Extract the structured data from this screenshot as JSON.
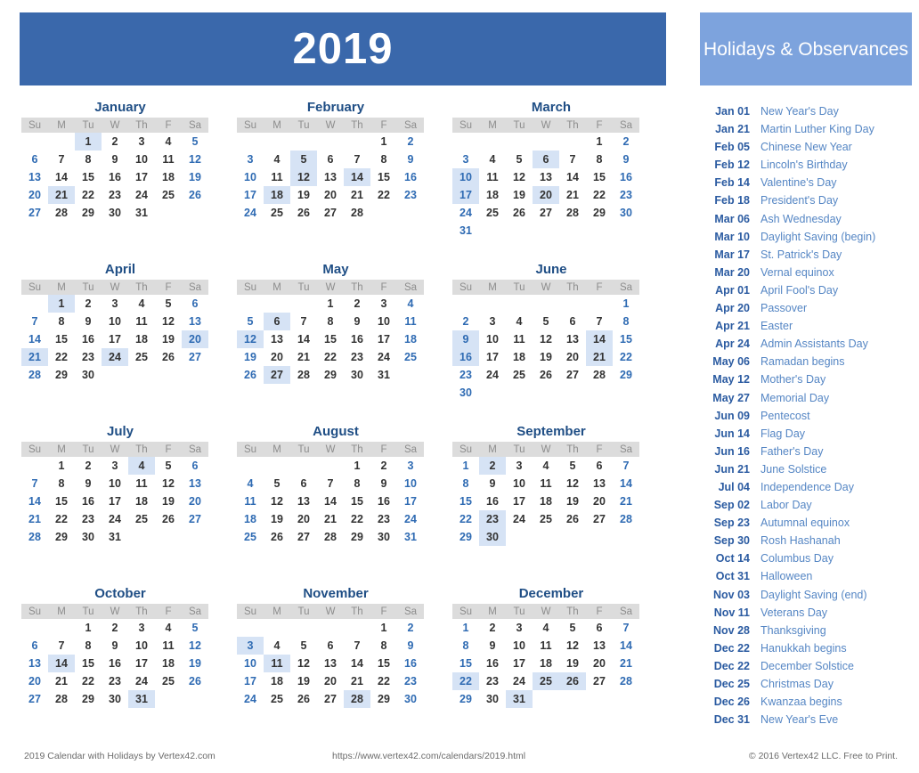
{
  "header": {
    "year": "2019",
    "bar_color": "#3a68ab"
  },
  "sidebar": {
    "title": "Holidays & Observances",
    "bar_color": "#7da3dd",
    "holidays": [
      {
        "date": "Jan 01",
        "name": "New Year's Day"
      },
      {
        "date": "Jan 21",
        "name": "Martin Luther King Day"
      },
      {
        "date": "Feb 05",
        "name": "Chinese New Year"
      },
      {
        "date": "Feb 12",
        "name": "Lincoln's Birthday"
      },
      {
        "date": "Feb 14",
        "name": "Valentine's Day"
      },
      {
        "date": "Feb 18",
        "name": "President's Day"
      },
      {
        "date": "Mar 06",
        "name": "Ash Wednesday"
      },
      {
        "date": "Mar 10",
        "name": "Daylight Saving (begin)"
      },
      {
        "date": "Mar 17",
        "name": "St. Patrick's Day"
      },
      {
        "date": "Mar 20",
        "name": "Vernal equinox"
      },
      {
        "date": "Apr 01",
        "name": "April Fool's Day"
      },
      {
        "date": "Apr 20",
        "name": "Passover"
      },
      {
        "date": "Apr 21",
        "name": "Easter"
      },
      {
        "date": "Apr 24",
        "name": "Admin Assistants Day"
      },
      {
        "date": "May 06",
        "name": "Ramadan begins"
      },
      {
        "date": "May 12",
        "name": "Mother's Day"
      },
      {
        "date": "May 27",
        "name": "Memorial Day"
      },
      {
        "date": "Jun 09",
        "name": "Pentecost"
      },
      {
        "date": "Jun 14",
        "name": "Flag Day"
      },
      {
        "date": "Jun 16",
        "name": "Father's Day"
      },
      {
        "date": "Jun 21",
        "name": "June Solstice"
      },
      {
        "date": "Jul 04",
        "name": "Independence Day"
      },
      {
        "date": "Sep 02",
        "name": "Labor Day"
      },
      {
        "date": "Sep 23",
        "name": "Autumnal equinox"
      },
      {
        "date": "Sep 30",
        "name": "Rosh Hashanah"
      },
      {
        "date": "Oct 14",
        "name": "Columbus Day"
      },
      {
        "date": "Oct 31",
        "name": "Halloween"
      },
      {
        "date": "Nov 03",
        "name": "Daylight Saving (end)"
      },
      {
        "date": "Nov 11",
        "name": "Veterans Day"
      },
      {
        "date": "Nov 28",
        "name": "Thanksgiving"
      },
      {
        "date": "Dec 22",
        "name": "Hanukkah begins"
      },
      {
        "date": "Dec 22",
        "name": "December Solstice"
      },
      {
        "date": "Dec 25",
        "name": "Christmas Day"
      },
      {
        "date": "Dec 26",
        "name": "Kwanzaa begins"
      },
      {
        "date": "Dec 31",
        "name": "New Year's Eve"
      }
    ]
  },
  "calendar": {
    "weekday_headers": [
      "Su",
      "M",
      "Tu",
      "W",
      "Th",
      "F",
      "Sa"
    ],
    "highlight_color": "#d6e3f5",
    "weekday_header_bg": "#dcdcdc",
    "weekend_color": "#2f6bb3",
    "months": [
      {
        "name": "January",
        "days": 31,
        "start": 2,
        "highlights": [
          1,
          21
        ]
      },
      {
        "name": "February",
        "days": 28,
        "start": 5,
        "highlights": [
          5,
          12,
          14,
          18
        ]
      },
      {
        "name": "March",
        "days": 31,
        "start": 5,
        "highlights": [
          6,
          10,
          17,
          20
        ]
      },
      {
        "name": "April",
        "days": 30,
        "start": 1,
        "highlights": [
          1,
          20,
          21,
          24
        ]
      },
      {
        "name": "May",
        "days": 31,
        "start": 3,
        "highlights": [
          6,
          12,
          27
        ]
      },
      {
        "name": "June",
        "days": 30,
        "start": 6,
        "highlights": [
          9,
          14,
          16,
          21
        ]
      },
      {
        "name": "July",
        "days": 31,
        "start": 1,
        "highlights": [
          4
        ]
      },
      {
        "name": "August",
        "days": 31,
        "start": 4,
        "highlights": []
      },
      {
        "name": "September",
        "days": 30,
        "start": 0,
        "highlights": [
          2,
          23,
          30
        ]
      },
      {
        "name": "October",
        "days": 31,
        "start": 2,
        "highlights": [
          14,
          31
        ]
      },
      {
        "name": "November",
        "days": 30,
        "start": 5,
        "highlights": [
          3,
          11,
          28
        ]
      },
      {
        "name": "December",
        "days": 31,
        "start": 0,
        "highlights": [
          22,
          25,
          26,
          31
        ]
      }
    ]
  },
  "footer": {
    "left": "2019 Calendar with Holidays by Vertex42.com",
    "center": "https://www.vertex42.com/calendars/2019.html",
    "right": "© 2016 Vertex42 LLC. Free to Print."
  }
}
